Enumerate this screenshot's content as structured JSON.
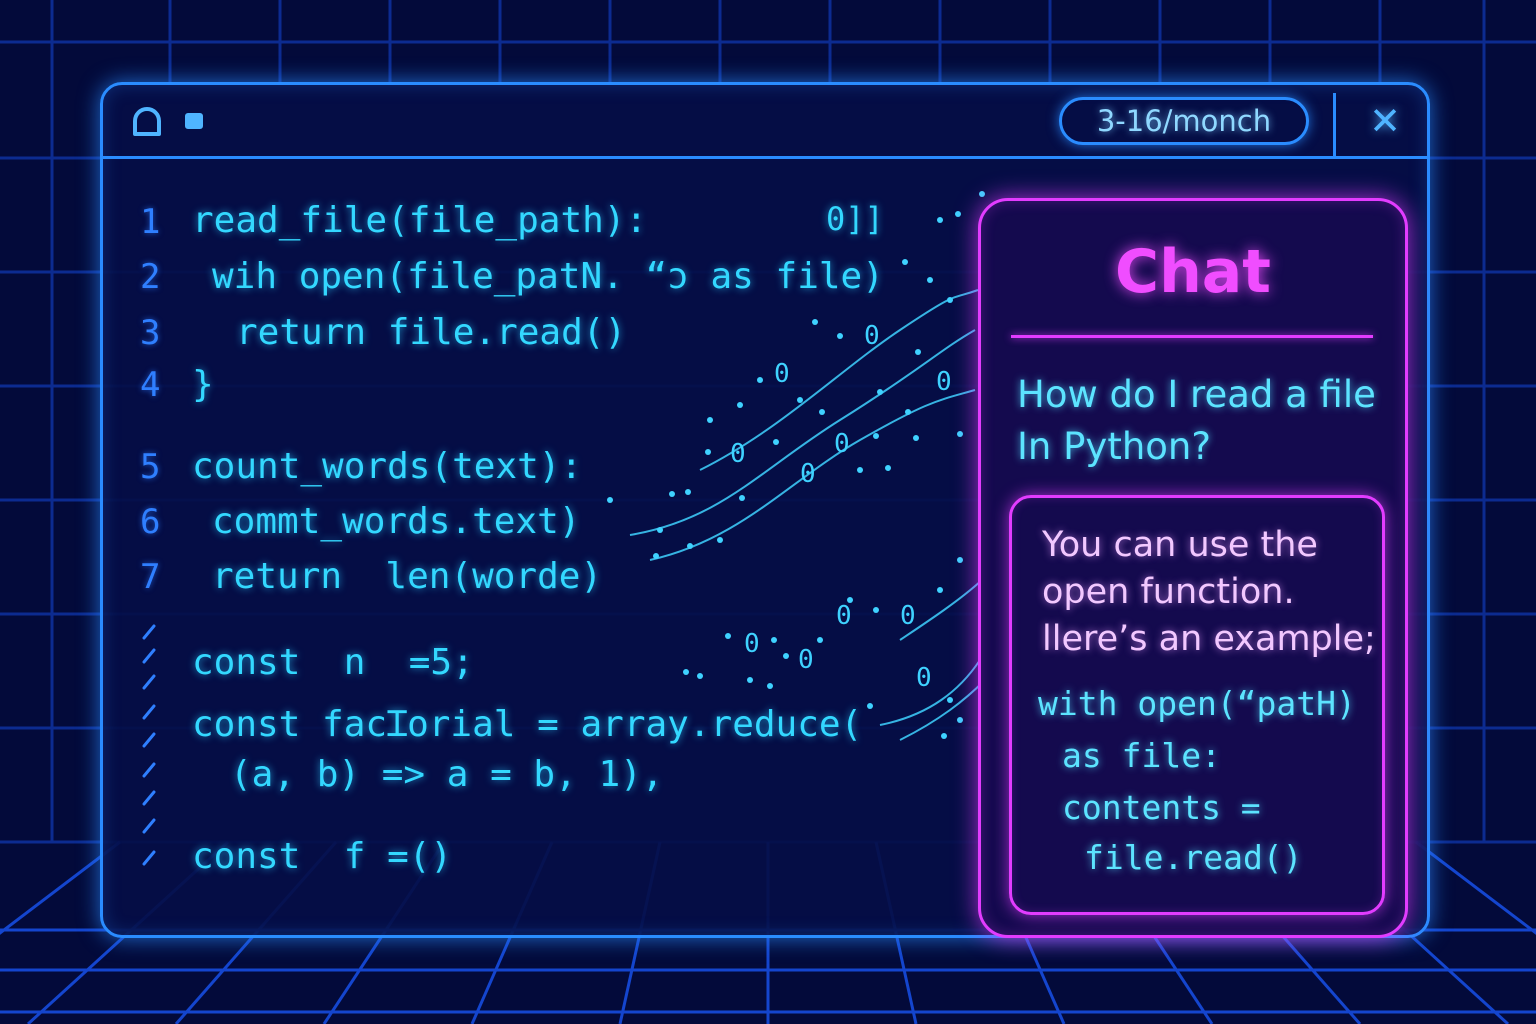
{
  "titlebar": {
    "price_badge": "3-16/monch",
    "close_label": "✕",
    "icons": [
      "bell-icon",
      "square-icon",
      "close-icon"
    ]
  },
  "editor": {
    "line_numbers": [
      "1",
      "2",
      "3",
      "4",
      "5",
      "6",
      "7"
    ],
    "lines": [
      "read_file(file_path):",
      "wih open(file_patN. “ɔ as file)",
      "return file.read()",
      "}",
      "count_words(text):",
      "commt_words.text)",
      "return  len(worde)",
      "const  n  =5;",
      "const facꞮorial = array.reduce(",
      "(a, b) => a = b, 1),",
      "const  f =()"
    ],
    "stray_glyphs": "0]]"
  },
  "chat": {
    "title": "Chat",
    "question": "How do I read a file In Python?",
    "answer_text": "You can use the open function. llere’s an example;",
    "answer_code": [
      "with open(“patH)",
      "as file:",
      "contents =",
      "file.read()"
    ]
  },
  "colors": {
    "background": "#030a3a",
    "window_border": "#2a8cff",
    "code_text": "#33d8ff",
    "chat_accent": "#e23cff",
    "chat_title": "#f04dff"
  }
}
